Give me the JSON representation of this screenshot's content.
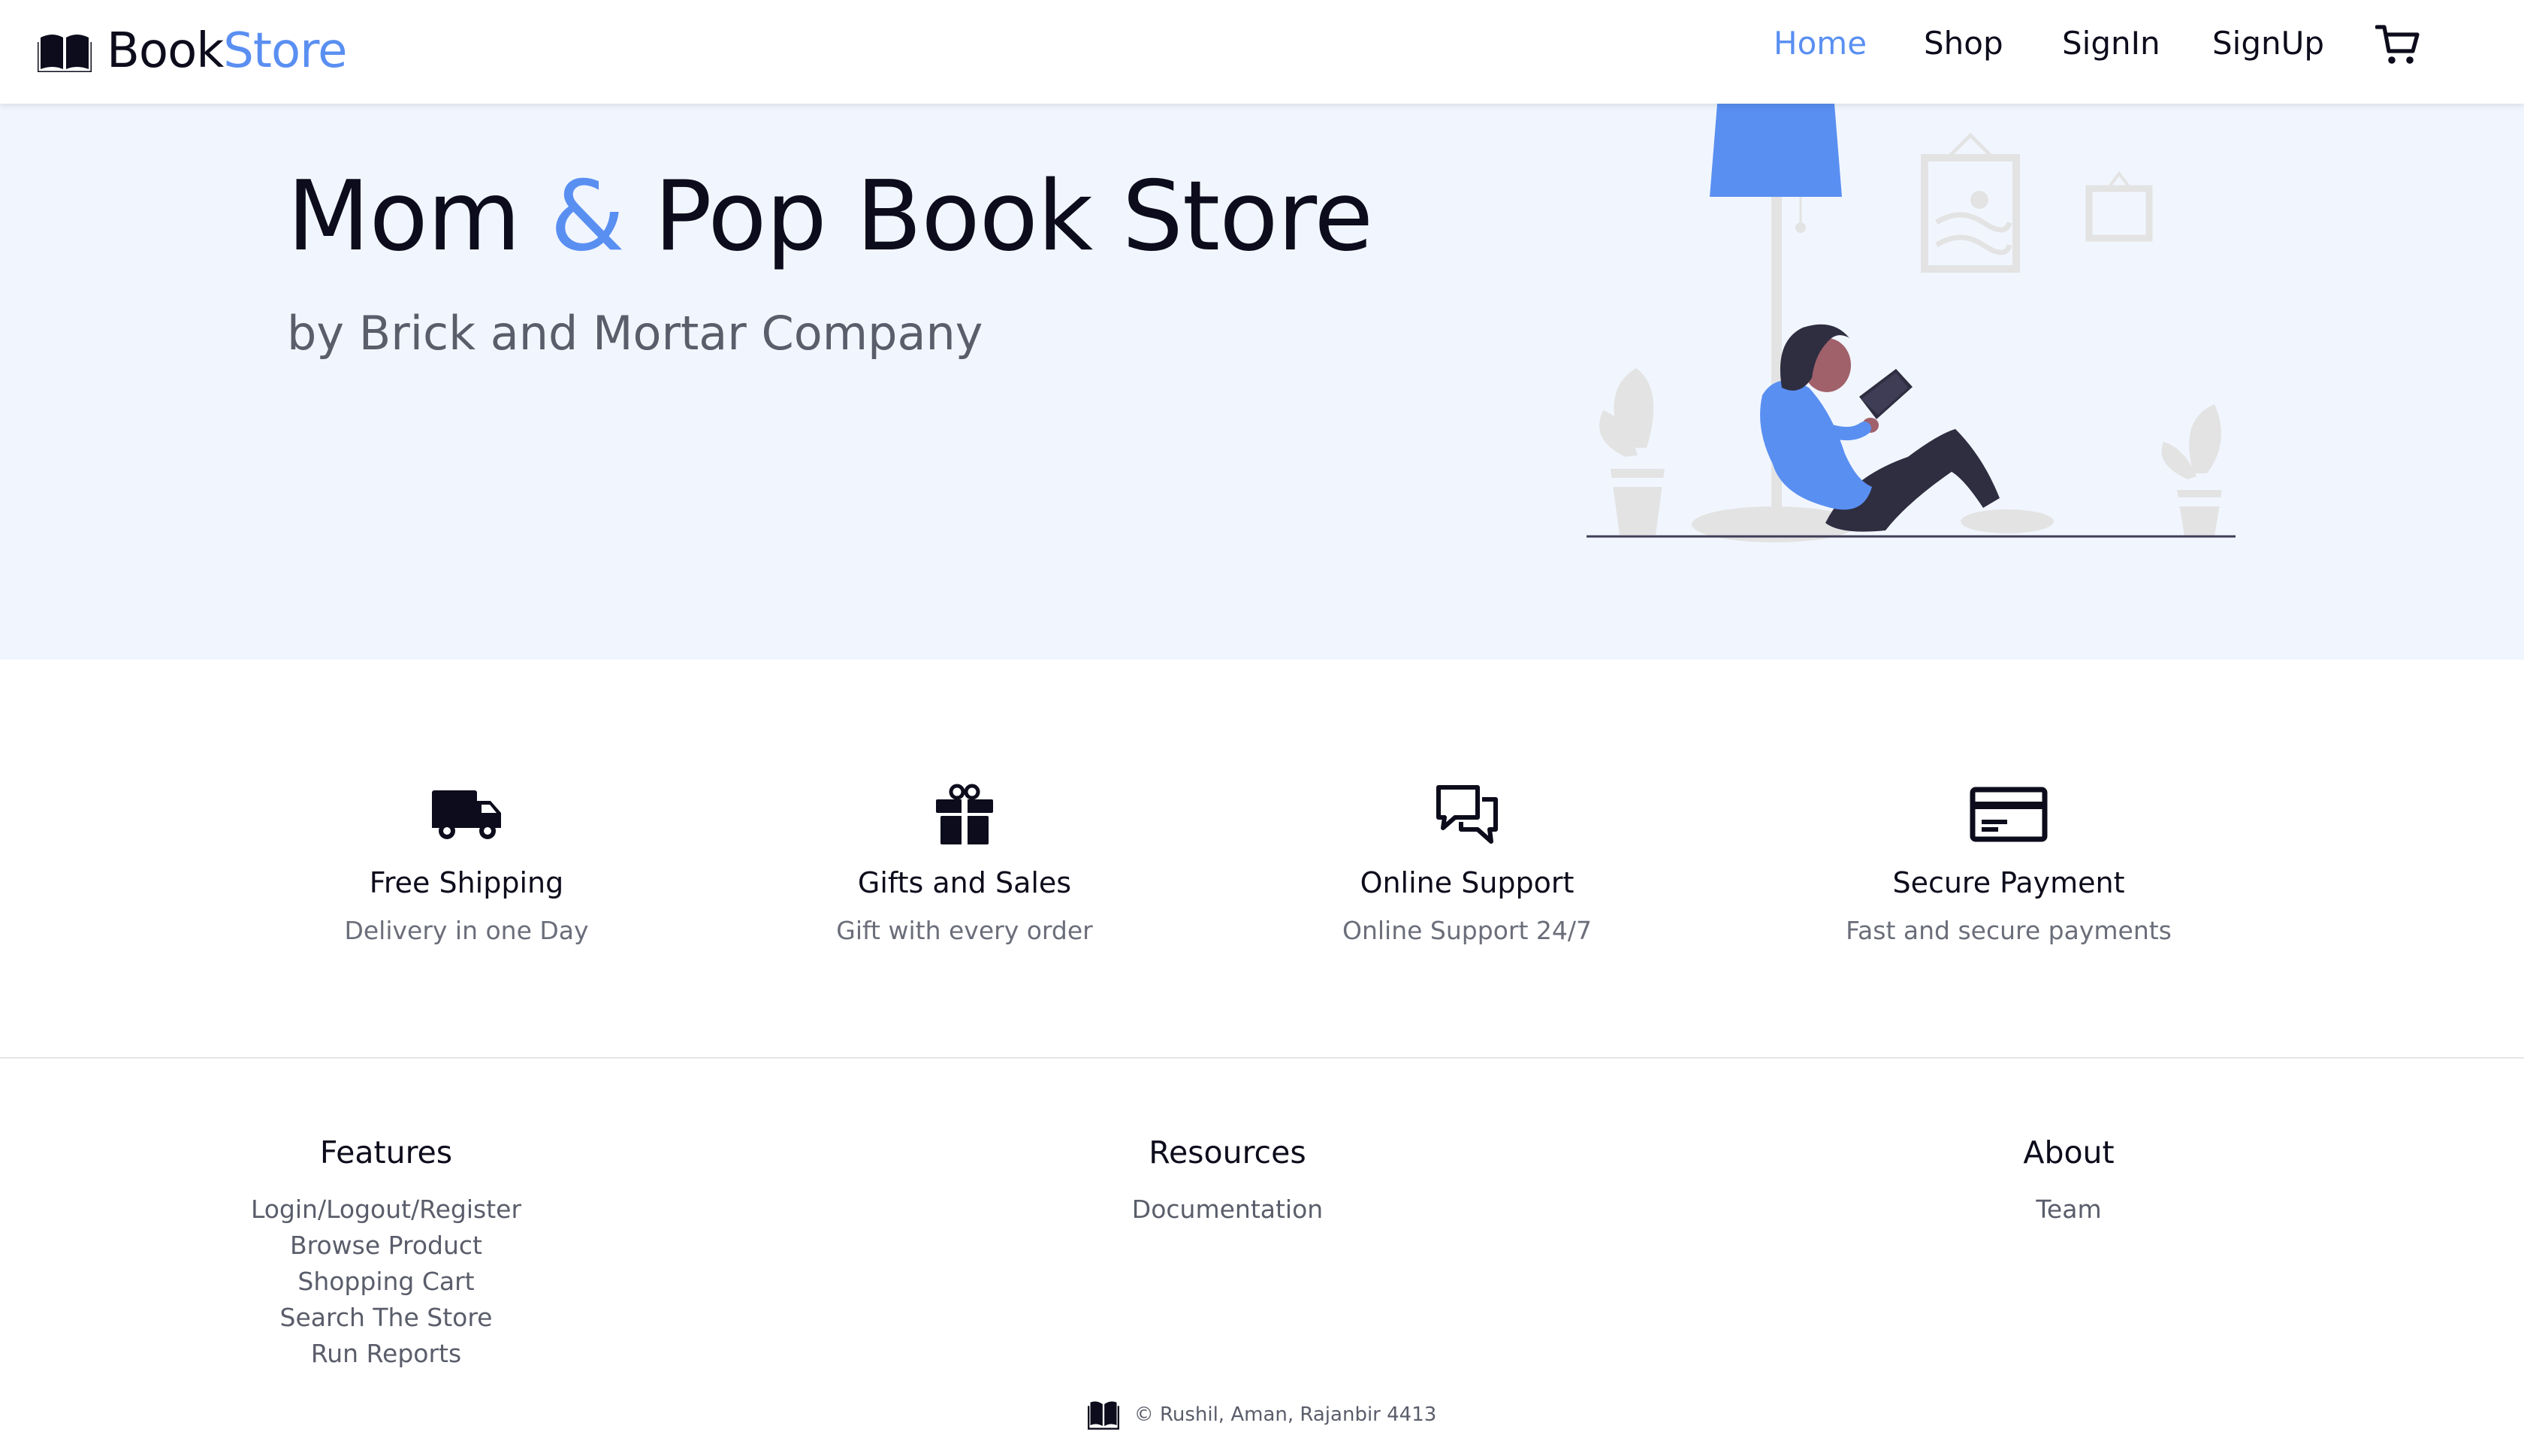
{
  "navbar": {
    "brand_part1": "Book",
    "brand_part2": "Store",
    "brand_icon": "open-book-icon",
    "links": [
      {
        "label": "Home",
        "active": true
      },
      {
        "label": "Shop",
        "active": false
      },
      {
        "label": "SignIn",
        "active": false
      },
      {
        "label": "SignUp",
        "active": false
      }
    ],
    "cart_icon": "cart-icon"
  },
  "hero": {
    "title_part1": "Mom",
    "title_amp": "&",
    "title_part2": "Pop Book Store",
    "subtitle": "by Brick and Mortar Company",
    "illustration": "woman-reading-illustration"
  },
  "features": [
    {
      "icon": "truck-icon",
      "title": "Free Shipping",
      "desc": "Delivery in one Day"
    },
    {
      "icon": "gift-icon",
      "title": "Gifts and Sales",
      "desc": "Gift with every order"
    },
    {
      "icon": "chat-icon",
      "title": "Online Support",
      "desc": "Online Support 24/7"
    },
    {
      "icon": "credit-card-icon",
      "title": "Secure Payment",
      "desc": "Fast and secure payments"
    }
  ],
  "footer": {
    "columns": [
      {
        "heading": "Features",
        "links": [
          "Login/Logout/Register",
          "Browse Product",
          "Shopping Cart",
          "Search The Store",
          "Run Reports"
        ]
      },
      {
        "heading": "Resources",
        "links": [
          "Documentation"
        ]
      },
      {
        "heading": "About",
        "links": [
          "Team"
        ]
      }
    ],
    "copyright": "© Rushil, Aman, Rajanbir 4413"
  },
  "colors": {
    "accent": "#5a8ff2",
    "hero_bg": "#f1f6fe",
    "text_dark": "#0c0c1c",
    "text_muted": "#5a5d6a"
  }
}
